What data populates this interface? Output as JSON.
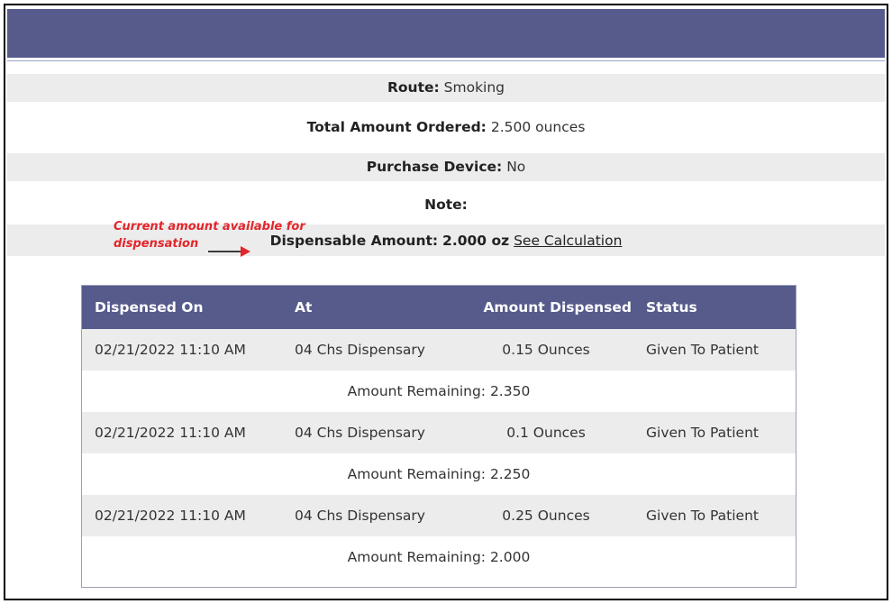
{
  "details": {
    "route_label": "Route:",
    "route_value": "Smoking",
    "total_label": "Total Amount Ordered:",
    "total_value": "2.500 ounces",
    "device_label": "Purchase Device:",
    "device_value": "No",
    "note_label": "Note:",
    "note_value": "",
    "dispensable_label": "Dispensable Amount:",
    "dispensable_value": "2.000 oz",
    "see_calc_link": "See Calculation"
  },
  "annotation": {
    "line1": "Current amount available for",
    "line2": "dispensation"
  },
  "table": {
    "headers": [
      "Dispensed On",
      "At",
      "Amount Dispensed",
      "Status"
    ],
    "rows": [
      {
        "date": "02/21/2022 11:10 AM",
        "at": "04 Chs Dispensary",
        "amount": "0.15 Ounces",
        "status": "Given To Patient",
        "remaining": "Amount Remaining: 2.350"
      },
      {
        "date": "02/21/2022 11:10 AM",
        "at": "04 Chs Dispensary",
        "amount": "0.1 Ounces",
        "status": "Given To Patient",
        "remaining": "Amount Remaining: 2.250"
      },
      {
        "date": "02/21/2022 11:10 AM",
        "at": "04 Chs Dispensary",
        "amount": "0.25 Ounces",
        "status": "Given To Patient",
        "remaining": "Amount Remaining: 2.000"
      }
    ]
  },
  "colors": {
    "header_bar": "#565b8c",
    "row_shade": "#ececec",
    "annotation": "#e3262b"
  }
}
